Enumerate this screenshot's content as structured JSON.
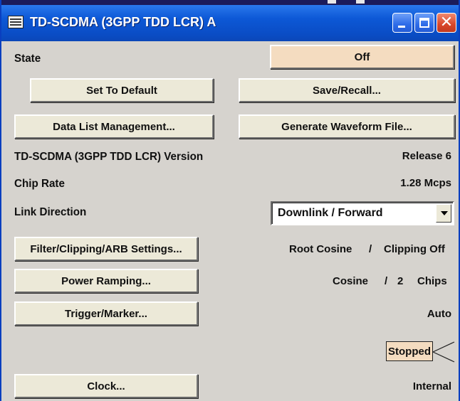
{
  "window": {
    "title": "TD-SCDMA (3GPP TDD LCR) A"
  },
  "state": {
    "label": "State",
    "button": "Off"
  },
  "actions": {
    "set_to_default": "Set To Default",
    "save_recall": "Save/Recall...",
    "data_list_management": "Data List Management...",
    "generate_waveform_file": "Generate Waveform File..."
  },
  "version": {
    "label": "TD-SCDMA (3GPP TDD LCR) Version",
    "value": "Release 6"
  },
  "chip_rate": {
    "label": "Chip Rate",
    "value": "1.28 Mcps"
  },
  "link_direction": {
    "label": "Link Direction",
    "selected": "Downlink / Forward"
  },
  "filter": {
    "button": "Filter/Clipping/ARB Settings...",
    "filter_value": "Root Cosine",
    "separator": "/",
    "clipping_value": "Clipping Off"
  },
  "power_ramping": {
    "button": "Power Ramping...",
    "shape": "Cosine",
    "separator": "/",
    "length": "2",
    "unit": "Chips"
  },
  "trigger": {
    "button": "Trigger/Marker...",
    "mode": "Auto",
    "status": "Stopped"
  },
  "clock": {
    "button": "Clock...",
    "source": "Internal"
  },
  "icons": [
    "window-app-icon",
    "minimize-icon",
    "maximize-icon",
    "close-icon",
    "dropdown-arrow-icon",
    "trigger-status-arrow-icon"
  ],
  "colors": {
    "titlebar": "#0a4cc4",
    "window_bg": "#d6d3ce",
    "button_face": "#ece9d8",
    "state_button": "#f4dcc0",
    "close_button": "#d9462a"
  }
}
